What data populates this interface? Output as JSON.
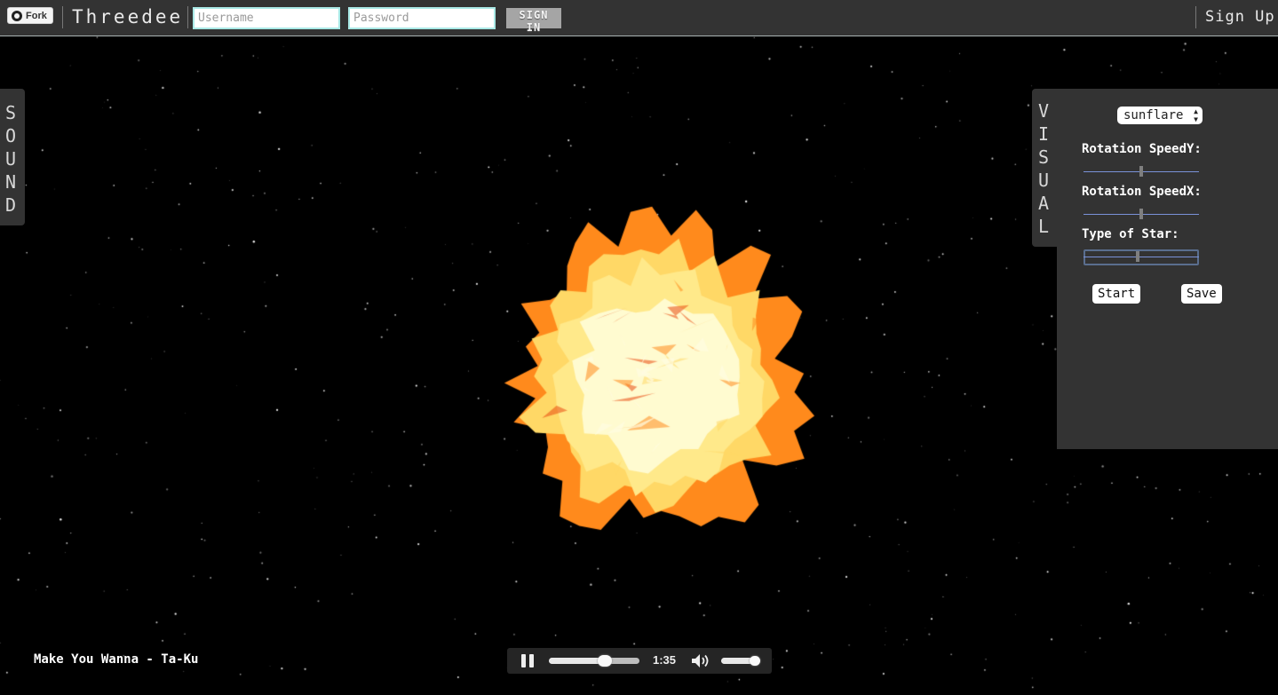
{
  "header": {
    "fork_label": "Fork",
    "brand": "Threedee",
    "username_placeholder": "Username",
    "password_placeholder": "Password",
    "signin_label": "SIGN IN",
    "signup_label": "Sign Up"
  },
  "sound_tab": {
    "letters": [
      "S",
      "O",
      "U",
      "N",
      "D"
    ]
  },
  "visual_tab": {
    "letters": [
      "V",
      "I",
      "S",
      "U",
      "A",
      "L"
    ]
  },
  "visual_panel": {
    "preset_value": "sunflare",
    "controls": [
      {
        "label": "Rotation SpeedY:",
        "value": 0.5
      },
      {
        "label": "Rotation SpeedX:",
        "value": 0.5
      },
      {
        "label": "Type of Star:",
        "value": 0.47
      }
    ],
    "start_label": "Start",
    "save_label": "Save"
  },
  "scene": {
    "object": "sunflare",
    "colors": [
      "#fffbd0",
      "#ffd866",
      "#ff8a1c",
      "#e94a10"
    ]
  },
  "player": {
    "track_title": "Make You Wanna - Ta-Ku",
    "time": "1:35",
    "progress": 0.62,
    "volume": 0.95
  },
  "colors": {
    "topbar": "#333333",
    "panel": "#333333",
    "field_border": "#a9e9e6"
  }
}
